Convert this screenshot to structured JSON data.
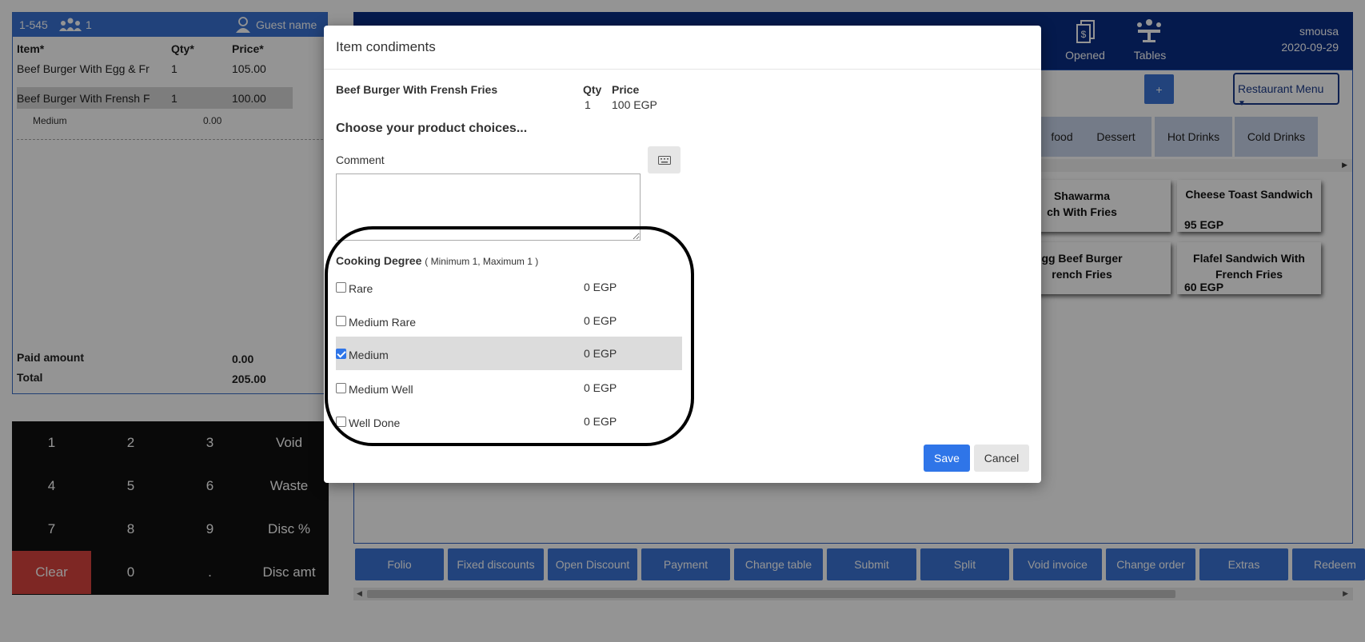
{
  "order": {
    "ref": "1-545",
    "guests": "1",
    "guest_name": "Guest name",
    "headers": {
      "item": "Item*",
      "qty": "Qty*",
      "price": "Price*"
    },
    "rows": [
      {
        "item": "Beef Burger With Egg & Fr",
        "qty": "1",
        "price": "105.00"
      },
      {
        "item": "Beef Burger With Frensh F",
        "qty": "1",
        "price": "100.00"
      }
    ],
    "condiment": {
      "name": "Medium",
      "price": "0.00"
    },
    "paid_label": "Paid amount",
    "paid_value": "0.00",
    "total_label": "Total",
    "total_value": "205.00"
  },
  "keypad": [
    "1",
    "2",
    "3",
    "Void",
    "4",
    "5",
    "6",
    "Waste",
    "7",
    "8",
    "9",
    "Disc %",
    "Clear",
    "0",
    ".",
    "Disc amt"
  ],
  "topbar": {
    "opened": "Opened",
    "tables": "Tables",
    "user": "smousa",
    "date": "2020-09-29",
    "plus": "+",
    "menu_select": "Restaurant Menu"
  },
  "categories": [
    "food",
    "Dessert",
    "Hot Drinks",
    "Cold Drinks"
  ],
  "products": [
    {
      "name": "Shawarma\nch With Fries",
      "price": ""
    },
    {
      "name": "Cheese Toast Sandwich",
      "price": "95 EGP"
    },
    {
      "name": "gg Beef Burger\nrench Fries",
      "price": ""
    },
    {
      "name": "Flafel Sandwich With French Fries",
      "price": "60 EGP"
    }
  ],
  "actions": [
    "Folio",
    "Fixed discounts",
    "Open Discount",
    "Payment",
    "Change table",
    "Submit",
    "Split",
    "Void invoice",
    "Change order",
    "Extras",
    "Redeem"
  ],
  "modal": {
    "title": "Item condiments",
    "item_name": "Beef Burger With Frensh Fries",
    "qty_label": "Qty",
    "price_label": "Price",
    "qty_value": "1",
    "price_value": "100 EGP",
    "choose_label": "Choose your product choices...",
    "comment_label": "Comment",
    "group_label": "Cooking Degree",
    "group_hint": "( Minimum 1, Maximum 1 )",
    "options": [
      {
        "label": "Rare",
        "price": "0 EGP",
        "checked": false
      },
      {
        "label": "Medium Rare",
        "price": "0 EGP",
        "checked": false
      },
      {
        "label": "Medium",
        "price": "0 EGP",
        "checked": true
      },
      {
        "label": "Medium Well",
        "price": "0 EGP",
        "checked": false
      },
      {
        "label": "Well Done",
        "price": "0 EGP",
        "checked": false
      }
    ],
    "save": "Save",
    "cancel": "Cancel"
  },
  "colors": {
    "accent": "#3b74d6",
    "topbar": "#0a2d86",
    "clear": "#d9443e",
    "save": "#2f75e8"
  }
}
